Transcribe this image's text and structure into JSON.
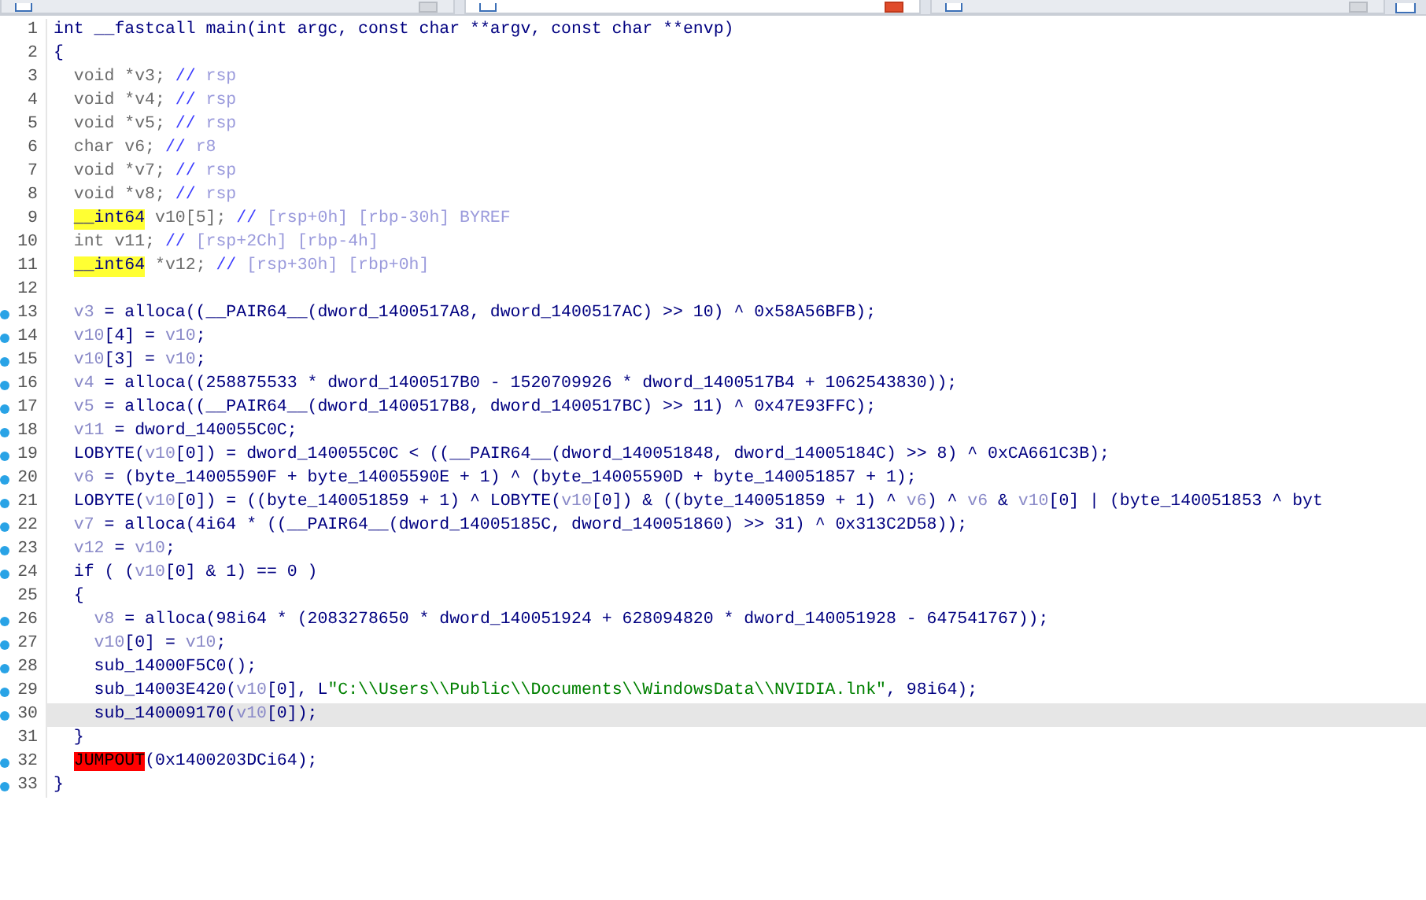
{
  "tabs": [
    {
      "selected": false
    },
    {
      "selected": true
    },
    {
      "selected": false
    }
  ],
  "lines": [
    {
      "number": "1",
      "marker": false,
      "current": false,
      "tokens": [
        {
          "kind": "plain",
          "text": "int __fastcall main(int argc, const char **argv, const char **envp)"
        }
      ]
    },
    {
      "number": "2",
      "marker": false,
      "current": false,
      "tokens": [
        {
          "kind": "plain",
          "text": "{"
        }
      ],
      "children": [
        {
          "number": "3",
          "marker": false,
          "current": false,
          "tokens": [
            {
              "kind": "decl",
              "text": "void *v3; "
            },
            {
              "kind": "slash",
              "text": "// "
            },
            {
              "kind": "reg",
              "text": "rsp"
            }
          ]
        },
        {
          "number": "4",
          "marker": false,
          "current": false,
          "tokens": [
            {
              "kind": "decl",
              "text": "void *v4; "
            },
            {
              "kind": "slash",
              "text": "// "
            },
            {
              "kind": "reg",
              "text": "rsp"
            }
          ]
        },
        {
          "number": "5",
          "marker": false,
          "current": false,
          "tokens": [
            {
              "kind": "decl",
              "text": "void *v5; "
            },
            {
              "kind": "slash",
              "text": "// "
            },
            {
              "kind": "reg",
              "text": "rsp"
            }
          ]
        },
        {
          "number": "6",
          "marker": false,
          "current": false,
          "tokens": [
            {
              "kind": "decl",
              "text": "char v6; "
            },
            {
              "kind": "slash",
              "text": "// "
            },
            {
              "kind": "reg",
              "text": "r8"
            }
          ]
        },
        {
          "number": "7",
          "marker": false,
          "current": false,
          "tokens": [
            {
              "kind": "decl",
              "text": "void *v7; "
            },
            {
              "kind": "slash",
              "text": "// "
            },
            {
              "kind": "reg",
              "text": "rsp"
            }
          ]
        },
        {
          "number": "8",
          "marker": false,
          "current": false,
          "tokens": [
            {
              "kind": "decl",
              "text": "void *v8; "
            },
            {
              "kind": "slash",
              "text": "// "
            },
            {
              "kind": "reg",
              "text": "rsp"
            }
          ]
        },
        {
          "number": "9",
          "marker": false,
          "current": false,
          "tokens": [
            {
              "kind": "marked",
              "text": "__int64"
            },
            {
              "kind": "decl",
              "text": " v10[5]; "
            },
            {
              "kind": "slash",
              "text": "// "
            },
            {
              "kind": "reg",
              "text": "[rsp+0h] [rbp-30h] BYREF"
            }
          ]
        },
        {
          "number": "10",
          "marker": false,
          "current": false,
          "tokens": [
            {
              "kind": "decl",
              "text": "int v11; "
            },
            {
              "kind": "slash",
              "text": "// "
            },
            {
              "kind": "reg",
              "text": "[rsp+2Ch] [rbp-4h]"
            }
          ]
        },
        {
          "number": "11",
          "marker": false,
          "current": false,
          "tokens": [
            {
              "kind": "marked",
              "text": "__int64"
            },
            {
              "kind": "decl",
              "text": " *v12; "
            },
            {
              "kind": "slash",
              "text": "// "
            },
            {
              "kind": "reg",
              "text": "[rsp+30h] [rbp+0h]"
            }
          ]
        },
        {
          "number": "12",
          "marker": false,
          "current": false
        },
        {
          "number": "13",
          "marker": true,
          "current": false,
          "tokens": [
            {
              "kind": "var",
              "text": "v3"
            },
            {
              "kind": "plain",
              "text": " = alloca((__PAIR64__(dword_1400517A8, dword_1400517AC) >> 10) ^ 0x58A56BFB);"
            }
          ]
        },
        {
          "number": "14",
          "marker": true,
          "current": false,
          "tokens": [
            {
              "kind": "var",
              "text": "v10"
            },
            {
              "kind": "plain",
              "text": "[4] = "
            },
            {
              "kind": "var",
              "text": "v10"
            },
            {
              "kind": "plain",
              "text": ";"
            }
          ]
        },
        {
          "number": "15",
          "marker": true,
          "current": false,
          "tokens": [
            {
              "kind": "var",
              "text": "v10"
            },
            {
              "kind": "plain",
              "text": "[3] = "
            },
            {
              "kind": "var",
              "text": "v10"
            },
            {
              "kind": "plain",
              "text": ";"
            }
          ]
        },
        {
          "number": "16",
          "marker": true,
          "current": false,
          "tokens": [
            {
              "kind": "var",
              "text": "v4"
            },
            {
              "kind": "plain",
              "text": " = alloca((258875533 * dword_1400517B0 - 1520709926 * dword_1400517B4 + 1062543830));"
            }
          ]
        },
        {
          "number": "17",
          "marker": true,
          "current": false,
          "tokens": [
            {
              "kind": "var",
              "text": "v5"
            },
            {
              "kind": "plain",
              "text": " = alloca((__PAIR64__(dword_1400517B8, dword_1400517BC) >> 11) ^ 0x47E93FFC);"
            }
          ]
        },
        {
          "number": "18",
          "marker": true,
          "current": false,
          "tokens": [
            {
              "kind": "var",
              "text": "v11"
            },
            {
              "kind": "plain",
              "text": " = dword_140055C0C;"
            }
          ]
        },
        {
          "number": "19",
          "marker": true,
          "current": false,
          "tokens": [
            {
              "kind": "plain",
              "text": "LOBYTE("
            },
            {
              "kind": "var",
              "text": "v10"
            },
            {
              "kind": "plain",
              "text": "[0]) = dword_140055C0C < ((__PAIR64__(dword_140051848, dword_14005184C) >> 8) ^ 0xCA661C3B);"
            }
          ]
        },
        {
          "number": "20",
          "marker": true,
          "current": false,
          "tokens": [
            {
              "kind": "var",
              "text": "v6"
            },
            {
              "kind": "plain",
              "text": " = (byte_14005590F + byte_14005590E + 1) ^ (byte_14005590D + byte_140051857 + 1);"
            }
          ]
        },
        {
          "number": "21",
          "marker": true,
          "current": false,
          "tokens": [
            {
              "kind": "plain",
              "text": "LOBYTE("
            },
            {
              "kind": "var",
              "text": "v10"
            },
            {
              "kind": "plain",
              "text": "[0]) = ((byte_140051859 + 1) ^ LOBYTE("
            },
            {
              "kind": "var",
              "text": "v10"
            },
            {
              "kind": "plain",
              "text": "[0]) & ((byte_140051859 + 1) ^ "
            },
            {
              "kind": "var",
              "text": "v6"
            },
            {
              "kind": "plain",
              "text": ") ^ "
            },
            {
              "kind": "var",
              "text": "v6"
            },
            {
              "kind": "plain",
              "text": " & "
            },
            {
              "kind": "var",
              "text": "v10"
            },
            {
              "kind": "plain",
              "text": "[0] | (byte_140051853 ^ byt"
            }
          ]
        },
        {
          "number": "22",
          "marker": true,
          "current": false,
          "tokens": [
            {
              "kind": "var",
              "text": "v7"
            },
            {
              "kind": "plain",
              "text": " = alloca(4i64 * ((__PAIR64__(dword_14005185C, dword_140051860) >> 31) ^ 0x313C2D58));"
            }
          ]
        },
        {
          "number": "23",
          "marker": true,
          "current": false,
          "tokens": [
            {
              "kind": "var",
              "text": "v12"
            },
            {
              "kind": "plain",
              "text": " = "
            },
            {
              "kind": "var",
              "text": "v10"
            },
            {
              "kind": "plain",
              "text": ";"
            }
          ]
        },
        {
          "number": "24",
          "marker": true,
          "current": false,
          "tokens": [
            {
              "kind": "plain",
              "text": "if ( ("
            },
            {
              "kind": "var",
              "text": "v10"
            },
            {
              "kind": "plain",
              "text": "[0] & 1) == 0 )"
            }
          ]
        },
        {
          "number": "25",
          "marker": false,
          "current": false,
          "tokens": [
            {
              "kind": "plain",
              "text": "{"
            }
          ],
          "children": [
            {
              "number": "26",
              "marker": true,
              "current": false,
              "tokens": [
                {
                  "kind": "var",
                  "text": "v8"
                },
                {
                  "kind": "plain",
                  "text": " = alloca(98i64 * (2083278650 * dword_140051924 + 628094820 * dword_140051928 - 647541767));"
                }
              ]
            },
            {
              "number": "27",
              "marker": true,
              "current": false,
              "tokens": [
                {
                  "kind": "var",
                  "text": "v10"
                },
                {
                  "kind": "plain",
                  "text": "[0] = "
                },
                {
                  "kind": "var",
                  "text": "v10"
                },
                {
                  "kind": "plain",
                  "text": ";"
                }
              ]
            },
            {
              "number": "28",
              "marker": true,
              "current": false,
              "tokens": [
                {
                  "kind": "plain",
                  "text": "sub_14000F5C0();"
                }
              ]
            },
            {
              "number": "29",
              "marker": true,
              "current": false,
              "tokens": [
                {
                  "kind": "plain",
                  "text": "sub_14003E420("
                },
                {
                  "kind": "var",
                  "text": "v10"
                },
                {
                  "kind": "plain",
                  "text": "[0], L"
                },
                {
                  "kind": "string",
                  "text": "\"C:\\\\Users\\\\Public\\\\Documents\\\\WindowsData\\\\NVIDIA.lnk\""
                },
                {
                  "kind": "plain",
                  "text": ", 98i64);"
                }
              ]
            },
            {
              "number": "30",
              "marker": true,
              "current": true,
              "tokens": [
                {
                  "kind": "plain",
                  "text": "sub_140009170("
                },
                {
                  "kind": "var",
                  "text": "v10"
                },
                {
                  "kind": "plain",
                  "text": "[0]);"
                }
              ]
            }
          ]
        },
        {
          "number": "31",
          "marker": false,
          "current": false,
          "tokens": [
            {
              "kind": "plain",
              "text": "}"
            }
          ]
        },
        {
          "number": "32",
          "marker": true,
          "current": false,
          "tokens": [
            {
              "kind": "error",
              "text": "JUMPOUT"
            },
            {
              "kind": "plain",
              "text": "(0x1400203DCi64);"
            }
          ]
        }
      ]
    },
    {
      "number": "33",
      "marker": true,
      "current": false,
      "tokens": [
        {
          "kind": "plain",
          "text": "}"
        }
      ]
    }
  ]
}
